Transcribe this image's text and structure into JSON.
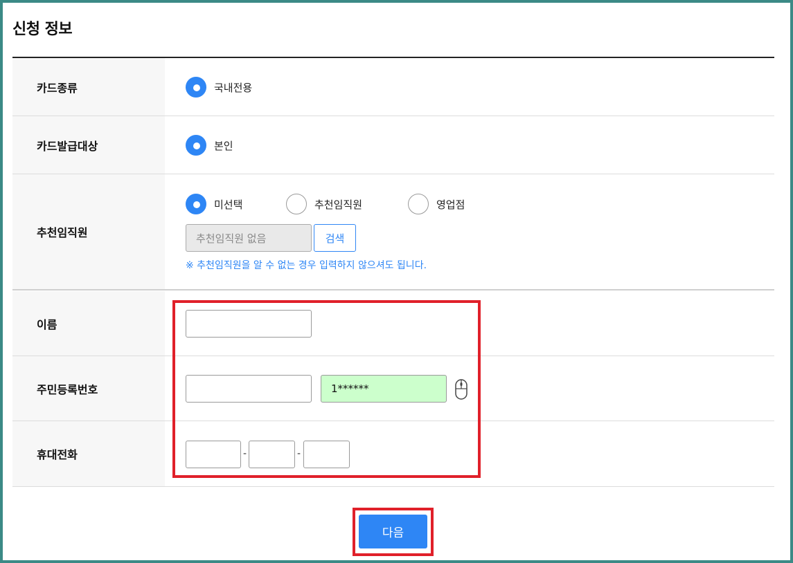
{
  "title": "신청 정보",
  "rows": {
    "card_type": {
      "label": "카드종류",
      "options": [
        {
          "label": "국내전용",
          "selected": true
        }
      ]
    },
    "card_target": {
      "label": "카드발급대상",
      "options": [
        {
          "label": "본인",
          "selected": true
        }
      ]
    },
    "recommender": {
      "label": "추천임직원",
      "options": [
        {
          "label": "미선택",
          "selected": true
        },
        {
          "label": "추천임직원",
          "selected": false
        },
        {
          "label": "영업점",
          "selected": false
        }
      ],
      "input_value": "추천임직원 없음",
      "search_label": "검색",
      "note": "※ 추천임직원을 알 수 없는 경우 입력하지 않으셔도 됩니다."
    },
    "name": {
      "label": "이름",
      "value": ""
    },
    "rrn": {
      "label": "주민등록번호",
      "front_value": "",
      "back_value": "1******"
    },
    "phone": {
      "label": "휴대전화",
      "part1": "",
      "part2": "",
      "part3": "",
      "separator": "-"
    }
  },
  "next_label": "다음",
  "colors": {
    "accent": "#2e86f5",
    "highlight": "#e0202a",
    "frame": "#3b8a86",
    "secure_field": "#ccffcc"
  },
  "icons": [
    "mouse-icon"
  ]
}
